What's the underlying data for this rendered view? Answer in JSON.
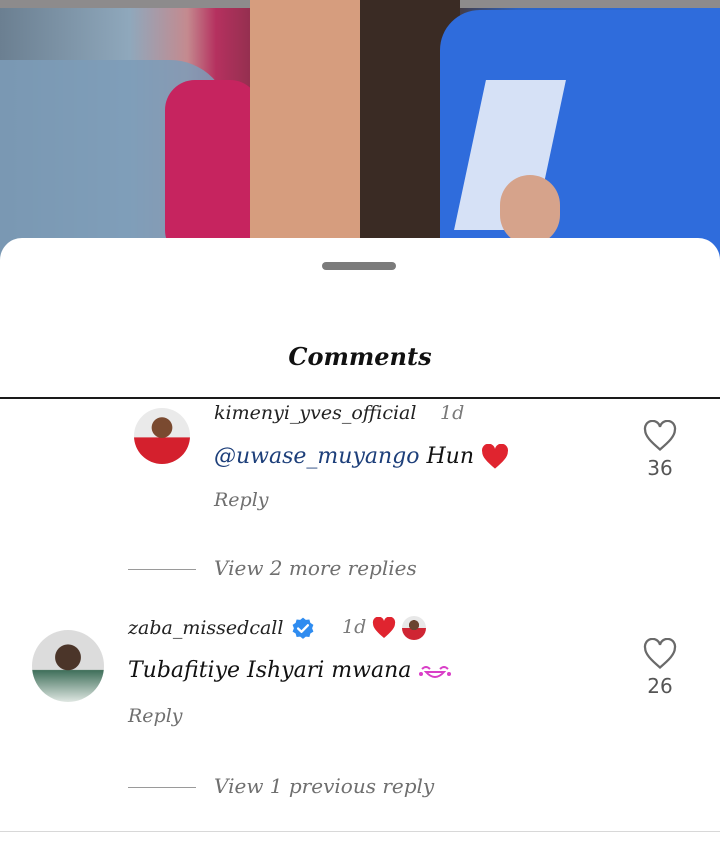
{
  "sheet": {
    "title": "Comments"
  },
  "comments": [
    {
      "username": "kimenyi_yves_official",
      "time": "1d",
      "mention": "@uwase_muyango",
      "text": "Hun",
      "reply_label": "Reply",
      "likes": "36",
      "view_more": "View 2 more replies"
    },
    {
      "username": "zaba_missedcall",
      "time": "1d",
      "text": "Tubafitiye Ishyari mwana",
      "reply_label": "Reply",
      "likes": "26",
      "view_more": "View 1 previous reply"
    }
  ],
  "icons": {
    "like": "heart-outline-icon",
    "verified": "verified-badge-icon",
    "heart": "red-heart-icon",
    "emoji": "laughing-emoji-icon"
  },
  "colors": {
    "mention": "#1d3f7a",
    "heart": "#e0242f",
    "verified": "#2f8cf0"
  }
}
